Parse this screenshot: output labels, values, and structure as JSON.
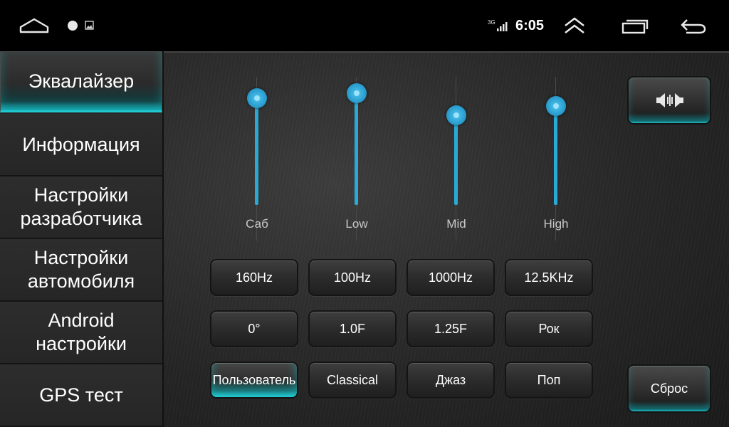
{
  "status_bar": {
    "time": "6:05",
    "network": "3G",
    "icons": [
      "home-icon",
      "notification-dot-icon",
      "image-icon",
      "signal-icon",
      "double-chevron-up-icon",
      "recent-apps-icon",
      "back-arrow-icon"
    ]
  },
  "sidebar": {
    "items": [
      {
        "label": "Эквалайзер",
        "active": true
      },
      {
        "label": "Информация",
        "active": false
      },
      {
        "label": "Настройки разработчика",
        "active": false
      },
      {
        "label": "Настройки автомобиля",
        "active": false
      },
      {
        "label": "Android настройки",
        "active": false
      },
      {
        "label": "GPS тест",
        "active": false
      }
    ]
  },
  "equalizer": {
    "bands": [
      {
        "label": "Саб",
        "level": 0.87
      },
      {
        "label": "Low",
        "level": 0.91
      },
      {
        "label": "Mid",
        "level": 0.73
      },
      {
        "label": "High",
        "level": 0.81
      }
    ],
    "accent_color": "#2aa9d6",
    "frequency_row": [
      "160Hz",
      "100Hz",
      "1000Hz",
      "12.5KHz"
    ],
    "parameter_row": [
      "0°",
      "1.0F",
      "1.25F",
      "Рок"
    ],
    "preset_row": [
      {
        "label": "Пользователь",
        "active": true
      },
      {
        "label": "Classical",
        "active": false
      },
      {
        "label": "Джаз",
        "active": false
      },
      {
        "label": "Поп",
        "active": false
      }
    ],
    "sound_field_icon": "speaker-balance-icon",
    "reset_label": "Сброс",
    "highlight_color": "#1ec4cb"
  }
}
